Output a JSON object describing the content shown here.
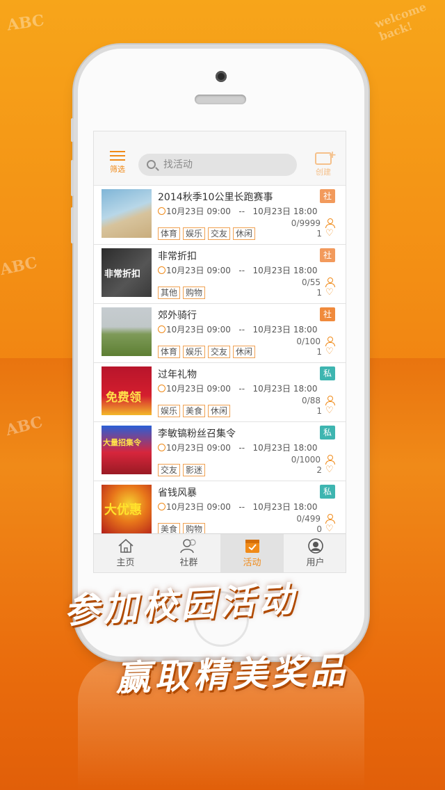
{
  "topbar": {
    "filter_label": "筛选",
    "search_placeholder": "找活动",
    "create_label": "创建"
  },
  "activities": [
    {
      "title": "2014秋季10公里长跑赛事",
      "type": "社",
      "type_color": "#f29a5c",
      "start": "10月23日  09:00",
      "sep": "--",
      "end": "10月23日  18:00",
      "count": "0/9999",
      "likes": "1",
      "tags": [
        "体育",
        "娱乐",
        "交友",
        "休闲"
      ],
      "thumb_text": ""
    },
    {
      "title": "非常折扣",
      "type": "社",
      "type_color": "#f29a5c",
      "start": "10月23日  09:00",
      "sep": "--",
      "end": "10月23日  18:00",
      "count": "0/55",
      "likes": "1",
      "tags": [
        "其他",
        "购物"
      ],
      "thumb_text": "非常折扣"
    },
    {
      "title": "郊外骑行",
      "type": "社",
      "type_color": "#f08a3c",
      "start": "10月23日  09:00",
      "sep": "--",
      "end": "10月23日  18:00",
      "count": "0/100",
      "likes": "1",
      "tags": [
        "体育",
        "娱乐",
        "交友",
        "休闲"
      ],
      "thumb_text": ""
    },
    {
      "title": "过年礼物",
      "type": "私",
      "type_color": "#3eb5b0",
      "start": "10月23日  09:00",
      "sep": "--",
      "end": "10月23日  18:00",
      "count": "0/88",
      "likes": "1",
      "tags": [
        "娱乐",
        "美食",
        "休闲"
      ],
      "thumb_text": "免费领"
    },
    {
      "title": "李敏镐粉丝召集令",
      "type": "私",
      "type_color": "#3eb5b0",
      "start": "10月23日  09:00",
      "sep": "--",
      "end": "10月23日  18:00",
      "count": "0/1000",
      "likes": "2",
      "tags": [
        "交友",
        "影迷"
      ],
      "thumb_text": "大量招集令"
    },
    {
      "title": "省钱风暴",
      "type": "私",
      "type_color": "#3eb5b0",
      "start": "10月23日  09:00",
      "sep": "--",
      "end": "10月23日  18:00",
      "count": "0/499",
      "likes": "0",
      "tags": [
        "美食",
        "购物"
      ],
      "thumb_text": "大优惠"
    }
  ],
  "nav": [
    {
      "label": "主页",
      "icon": "home-icon",
      "active": false
    },
    {
      "label": "社群",
      "icon": "community-icon",
      "active": false
    },
    {
      "label": "活动",
      "icon": "activity-icon",
      "active": true
    },
    {
      "label": "用户",
      "icon": "user-icon",
      "active": false
    }
  ],
  "slogan": {
    "line1": "参加校园活动",
    "line2": "赢取精美奖品"
  },
  "background": {
    "doodle_abc": "ABC",
    "doodle_welcome": "welcome back!"
  },
  "colors": {
    "accent": "#f08a18",
    "social_badge": "#f29a5c",
    "private_badge": "#3eb5b0"
  }
}
